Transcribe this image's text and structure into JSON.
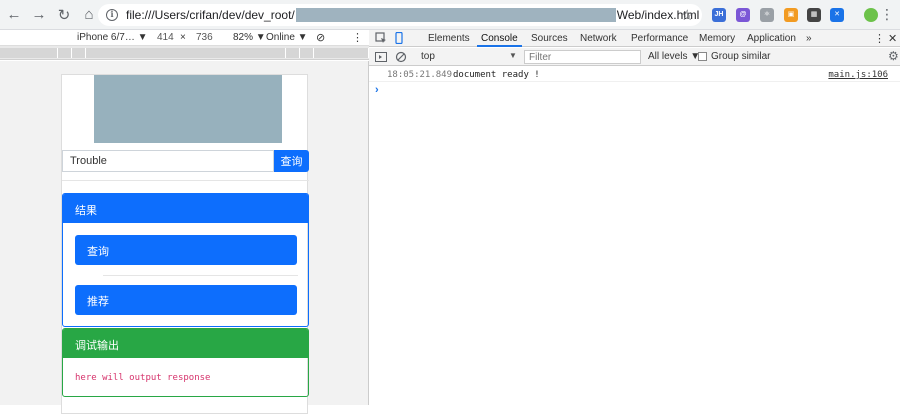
{
  "browser": {
    "url_prefix": "file:///Users/crifan/dev/dev_root/",
    "url_suffix": "Web/index.html",
    "extensions": [
      {
        "name": "jh-extension-icon",
        "label": "JH",
        "color": "#3b6fd8"
      },
      {
        "name": "spiral-extension-icon",
        "label": "@",
        "color": "#7b57d6"
      },
      {
        "name": "react-extension-icon",
        "label": "⚛",
        "color": "#9aa0a6"
      },
      {
        "name": "orange-extension-icon",
        "label": "▣",
        "color": "#f29b22"
      },
      {
        "name": "qr-extension-icon",
        "label": "▦",
        "color": "#444"
      },
      {
        "name": "blue-extension-icon",
        "label": "✕",
        "color": "#1a73e8"
      },
      {
        "name": "green-extension-icon",
        "label": "",
        "color": "#6cc24a"
      }
    ]
  },
  "device_toolbar": {
    "device": "iPhone 6/7… ▼",
    "width": "414",
    "times": "×",
    "height": "736",
    "zoom": "82% ▼",
    "network": "Online ▼"
  },
  "page": {
    "search_value": "Trouble",
    "search_button": "查询",
    "result_title": "结果",
    "result_items": [
      "查询",
      "推荐"
    ],
    "debug_title": "调试输出",
    "debug_output": "here will output response"
  },
  "devtools": {
    "tabs": [
      "Elements",
      "Console",
      "Sources",
      "Network",
      "Performance",
      "Memory",
      "Application"
    ],
    "more": "»",
    "active_tab": "Console",
    "context": "top",
    "filter_placeholder": "Filter",
    "levels": "All levels ▼",
    "group_similar": "Group similar",
    "log": {
      "time": "18:05:21.849",
      "message": "document ready !",
      "source": "main.js:106"
    },
    "prompt": "›"
  }
}
